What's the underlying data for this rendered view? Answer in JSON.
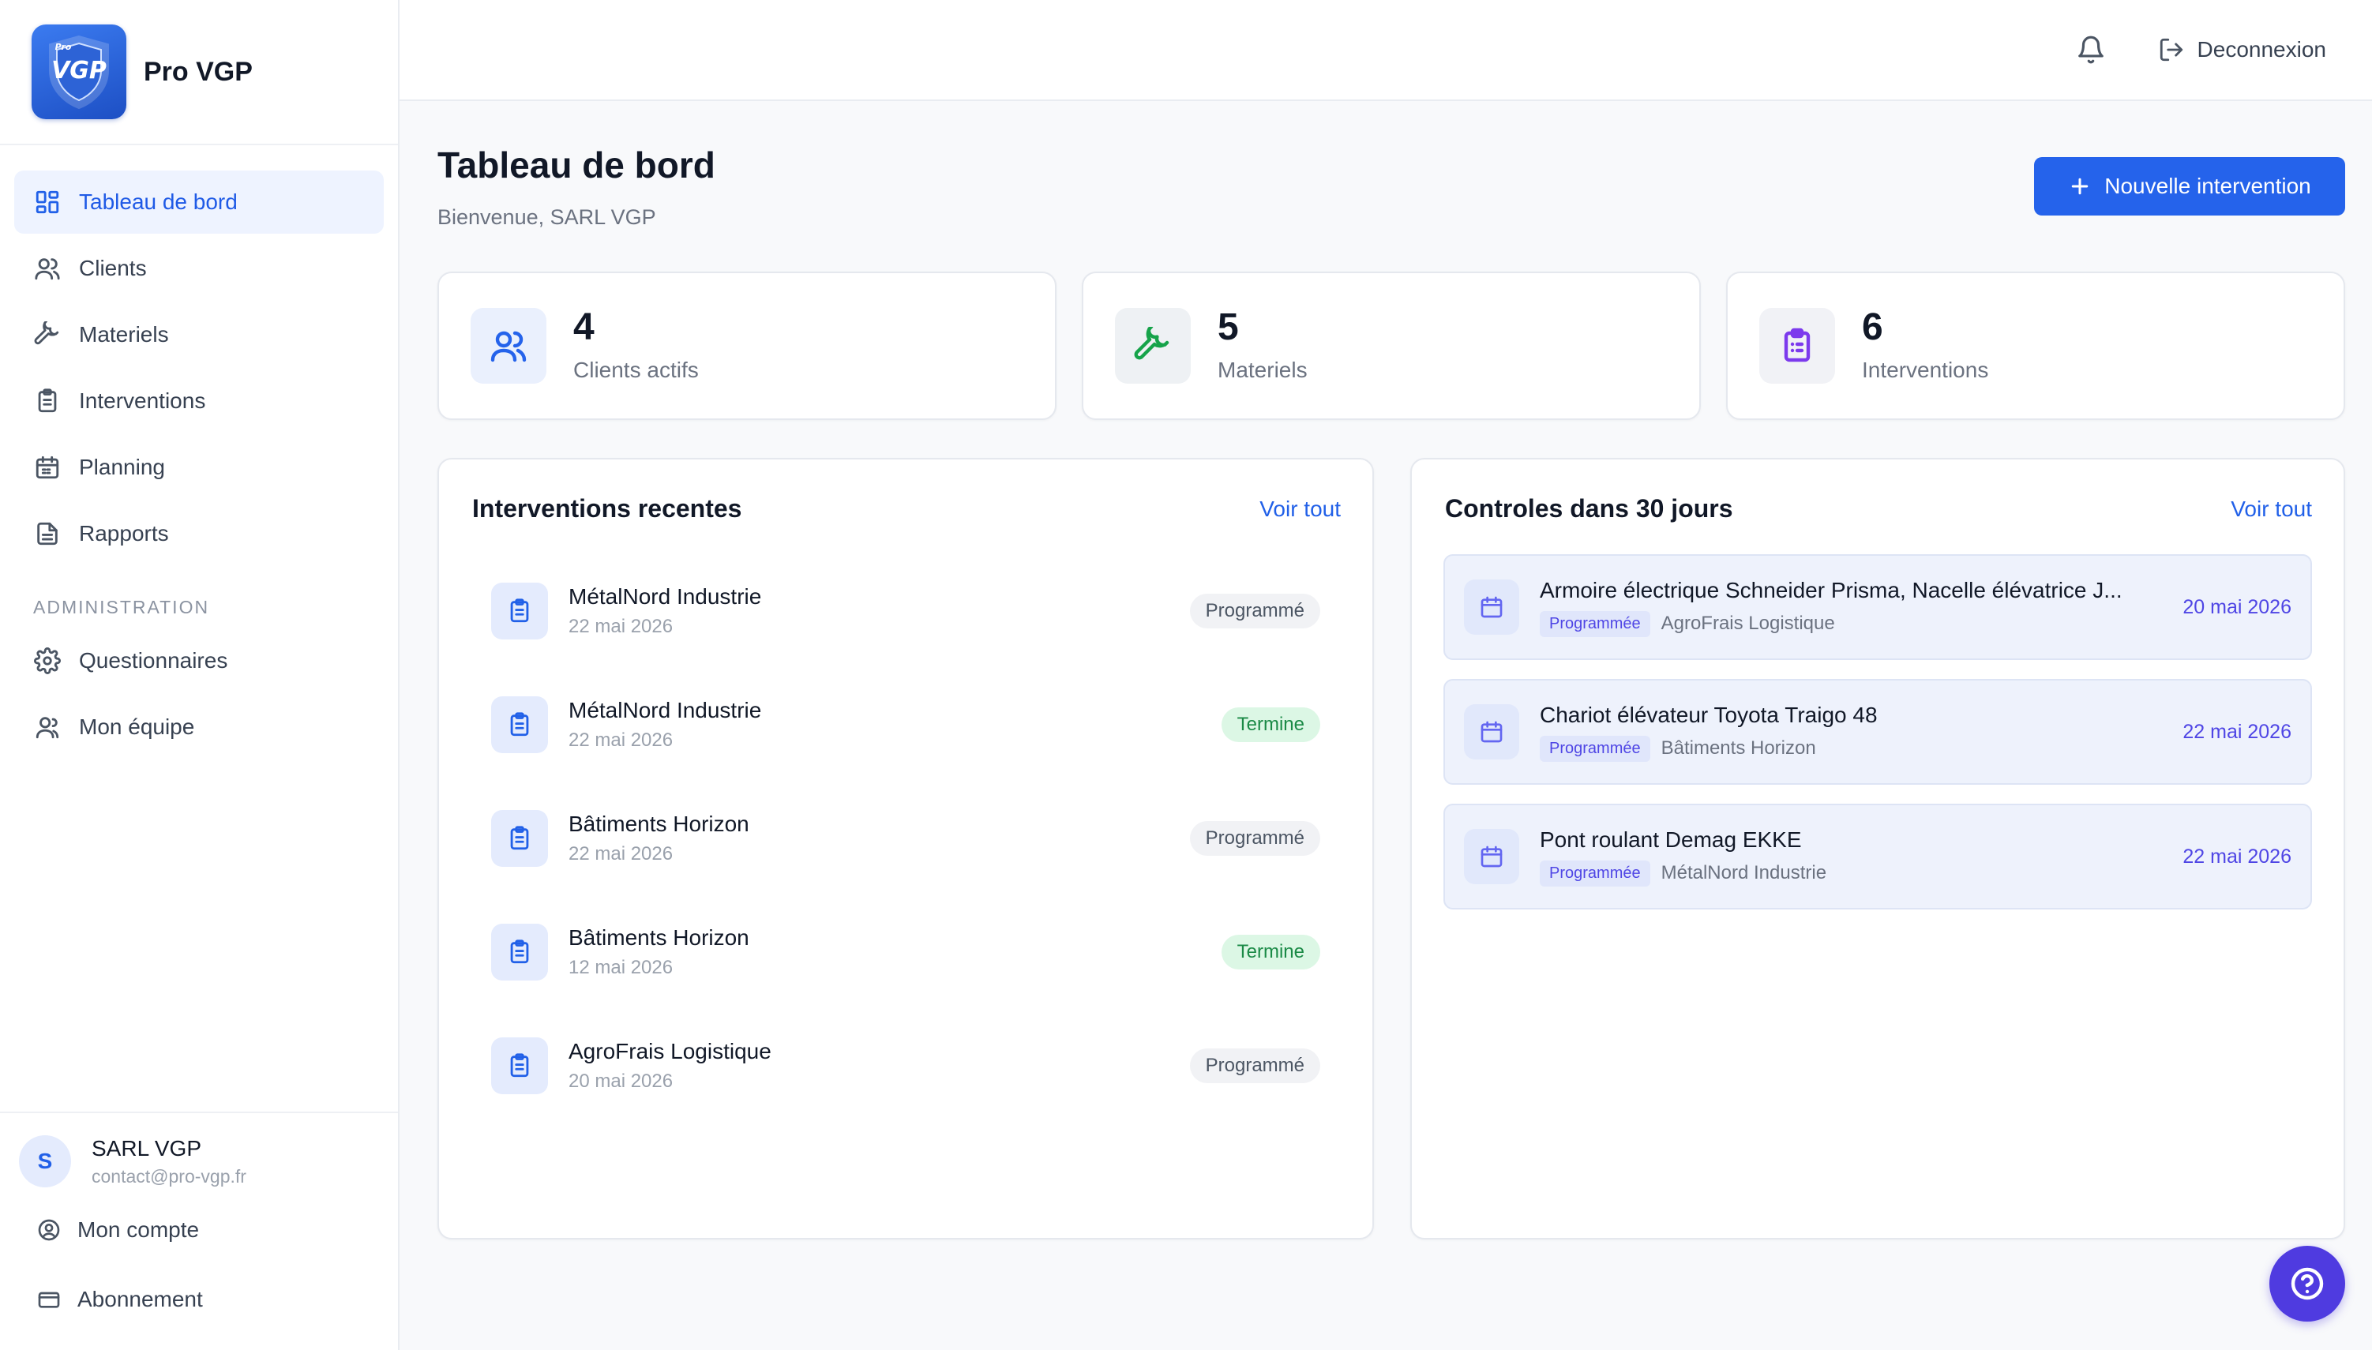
{
  "brand": {
    "name": "Pro VGP",
    "logo_text": "VGP",
    "logo_small": "Pro"
  },
  "topbar": {
    "notifications_icon": "bell-icon",
    "logout_label": "Deconnexion"
  },
  "sidebar": {
    "items": [
      {
        "label": "Tableau de bord",
        "icon": "dashboard-icon",
        "active": true
      },
      {
        "label": "Clients",
        "icon": "users-icon"
      },
      {
        "label": "Materiels",
        "icon": "wrench-icon"
      },
      {
        "label": "Interventions",
        "icon": "clipboard-icon"
      },
      {
        "label": "Planning",
        "icon": "calendar-icon"
      },
      {
        "label": "Rapports",
        "icon": "document-icon"
      }
    ],
    "section_label": "ADMINISTRATION",
    "admin_items": [
      {
        "label": "Questionnaires",
        "icon": "gear-icon"
      },
      {
        "label": "Mon équipe",
        "icon": "team-icon"
      }
    ]
  },
  "user": {
    "initial": "S",
    "name": "SARL VGP",
    "email": "contact@pro-vgp.fr",
    "account_label": "Mon compte",
    "subscription_label": "Abonnement"
  },
  "page": {
    "title": "Tableau de bord",
    "subtitle": "Bienvenue, SARL VGP",
    "new_button": "Nouvelle intervention"
  },
  "stats": [
    {
      "value": "4",
      "label": "Clients actifs",
      "icon": "users-icon",
      "color": "#2563eb",
      "bg": "#eaf0fd"
    },
    {
      "value": "5",
      "label": "Materiels",
      "icon": "wrench-icon",
      "color": "#16a34a",
      "bg": "#eef1f4"
    },
    {
      "value": "6",
      "label": "Interventions",
      "icon": "clipboard-icon",
      "color": "#7c3aed",
      "bg": "#f1f2f6"
    }
  ],
  "recent": {
    "title": "Interventions recentes",
    "see_all": "Voir tout",
    "items": [
      {
        "client": "MétalNord Industrie",
        "date": "22 mai 2026",
        "status": "Programmé",
        "status_type": "prog"
      },
      {
        "client": "MétalNord Industrie",
        "date": "22 mai 2026",
        "status": "Termine",
        "status_type": "term"
      },
      {
        "client": "Bâtiments Horizon",
        "date": "22 mai 2026",
        "status": "Programmé",
        "status_type": "prog"
      },
      {
        "client": "Bâtiments Horizon",
        "date": "12 mai 2026",
        "status": "Termine",
        "status_type": "term"
      },
      {
        "client": "AgroFrais Logistique",
        "date": "20 mai 2026",
        "status": "Programmé",
        "status_type": "prog"
      }
    ]
  },
  "controls": {
    "title": "Controles dans 30 jours",
    "see_all": "Voir tout",
    "items": [
      {
        "equipment": "Armoire électrique Schneider Prisma, Nacelle élévatrice J...",
        "status": "Programmée",
        "client": "AgroFrais Logistique",
        "date": "20 mai 2026"
      },
      {
        "equipment": "Chariot élévateur Toyota Traigo 48",
        "status": "Programmée",
        "client": "Bâtiments Horizon",
        "date": "22 mai 2026"
      },
      {
        "equipment": "Pont roulant Demag EKKE",
        "status": "Programmée",
        "client": "MétalNord Industrie",
        "date": "22 mai 2026"
      }
    ]
  },
  "help_icon": "help-circle-icon"
}
